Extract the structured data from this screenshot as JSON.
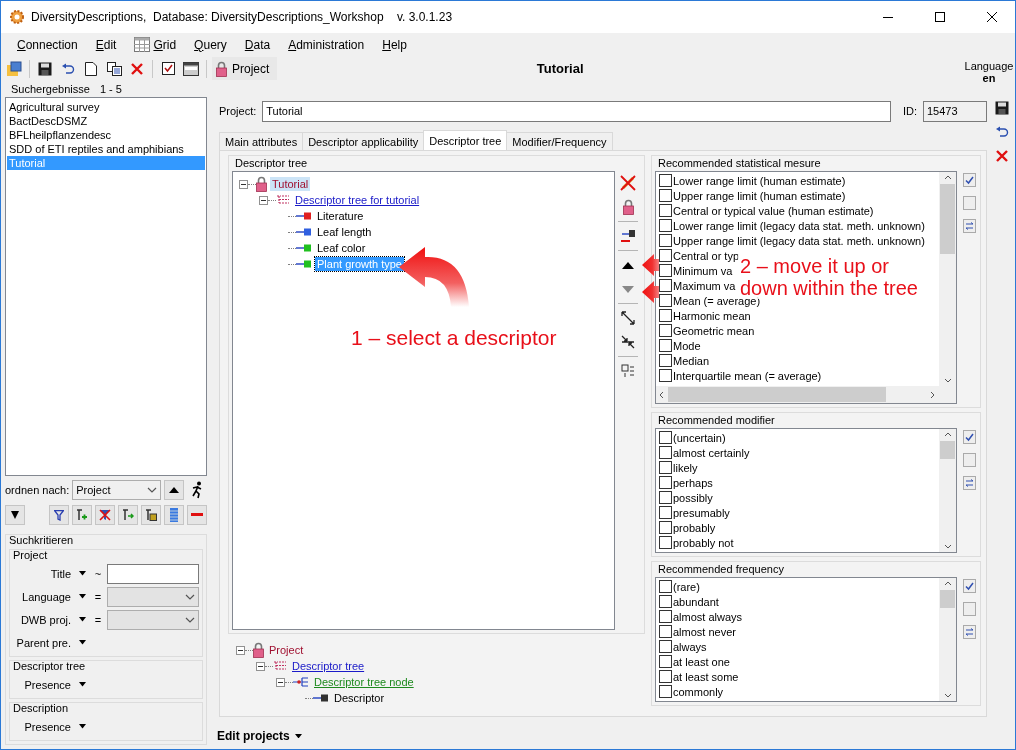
{
  "window": {
    "title": "DiversityDescriptions,  Database: DiversityDescriptions_Workshop    v. 3.0.1.23"
  },
  "menu": [
    {
      "label": "Connection",
      "icon": false
    },
    {
      "label": "Edit",
      "icon": false
    },
    {
      "label": "Grid",
      "icon": true
    },
    {
      "label": "Query",
      "icon": false
    },
    {
      "label": "Data",
      "icon": false
    },
    {
      "label": "Administration",
      "icon": false
    },
    {
      "label": "Help",
      "icon": false
    }
  ],
  "toolbar": {
    "project_button": "Project",
    "title": "Tutorial",
    "language_label": "Language",
    "language": "en"
  },
  "search_results": {
    "label": "Suchergebnisse",
    "range": "1 - 5",
    "items": [
      {
        "label": "Agricultural survey",
        "selected": false
      },
      {
        "label": "BactDescDSMZ",
        "selected": false
      },
      {
        "label": "BFLheilpflanzendesc",
        "selected": false
      },
      {
        "label": "SDD of ETI reptiles and amphibians",
        "selected": false
      },
      {
        "label": "Tutorial",
        "selected": true
      }
    ]
  },
  "sort": {
    "label": "ordnen nach:",
    "value": "Project"
  },
  "search_criteria": {
    "title": "Suchkritieren",
    "groups": [
      {
        "title": "Project",
        "fields": [
          {
            "label": "Title",
            "operator": "~",
            "kind": "text"
          },
          {
            "label": "Language",
            "operator": "=",
            "kind": "select"
          },
          {
            "label": "DWB proj.",
            "operator": "=",
            "kind": "select"
          },
          {
            "label": "Parent pre.",
            "kind": "none"
          }
        ]
      },
      {
        "title": "Descriptor tree",
        "fields": [
          {
            "label": "Presence",
            "kind": "none"
          }
        ]
      },
      {
        "title": "Description",
        "fields": [
          {
            "label": "Presence",
            "kind": "none"
          }
        ]
      }
    ]
  },
  "project": {
    "label": "Project:",
    "value": "Tutorial",
    "id_label": "ID:",
    "id": "15473"
  },
  "tabs": [
    {
      "label": "Main attributes",
      "selected": false
    },
    {
      "label": "Descriptor applicability",
      "selected": false
    },
    {
      "label": "Descriptor tree",
      "selected": true
    },
    {
      "label": "Modifier/Frequency",
      "selected": false
    }
  ],
  "descriptor_tree": {
    "title": "Descriptor tree",
    "nodes": [
      {
        "label": "Tutorial",
        "kind": "project",
        "selected": false,
        "highlighted": true,
        "children": [
          {
            "label": "Descriptor tree for tutorial",
            "kind": "tree",
            "selected": false,
            "highlighted": false,
            "children": [
              {
                "label": "Literature",
                "kind": "descriptor",
                "color": "#e02020",
                "selected": false,
                "highlighted": false
              },
              {
                "label": "Leaf length",
                "kind": "descriptor",
                "color": "#2f5fe0",
                "selected": false,
                "highlighted": false
              },
              {
                "label": "Leaf color",
                "kind": "descriptor",
                "color": "#20c020",
                "selected": false,
                "highlighted": false
              },
              {
                "label": "Plant growth type",
                "kind": "descriptor",
                "color": "#20c020",
                "selected": true,
                "highlighted": false
              }
            ]
          }
        ]
      }
    ]
  },
  "legend_tree": [
    {
      "label": "Project",
      "kind": "project",
      "children": [
        {
          "label": "Descriptor tree",
          "kind": "tree",
          "children": [
            {
              "label": "Descriptor tree node",
              "kind": "node",
              "children": [
                {
                  "label": "Descriptor",
                  "kind": "descriptor",
                  "color": "#303030"
                }
              ]
            }
          ]
        }
      ]
    }
  ],
  "stat_measures": {
    "title": "Recommended statistical mesure",
    "items": [
      {
        "label": "Lower range limit (human estimate)",
        "checked": false
      },
      {
        "label": "Upper range limit (human estimate)",
        "checked": false
      },
      {
        "label": "Central or typical value (human estimate)",
        "checked": false
      },
      {
        "label": "Lower range limit (legacy data stat. meth. unknown)",
        "checked": false
      },
      {
        "label": "Upper range limit (legacy data stat. meth. unknown)",
        "checked": false
      },
      {
        "label": "Central or typ",
        "checked": false
      },
      {
        "label": "Minimum va",
        "checked": false
      },
      {
        "label": "Maximum va",
        "checked": false
      },
      {
        "label": "Mean (= average)",
        "checked": false
      },
      {
        "label": "Harmonic mean",
        "checked": false
      },
      {
        "label": "Geometric mean",
        "checked": false
      },
      {
        "label": "Mode",
        "checked": false
      },
      {
        "label": "Median",
        "checked": false
      },
      {
        "label": "Interquartile mean (= average)",
        "checked": false
      }
    ]
  },
  "modifiers": {
    "title": "Recommended modifier",
    "items": [
      {
        "label": "(uncertain)",
        "checked": false
      },
      {
        "label": "almost certainly",
        "checked": false
      },
      {
        "label": "likely",
        "checked": false
      },
      {
        "label": "perhaps",
        "checked": false
      },
      {
        "label": "possibly",
        "checked": false
      },
      {
        "label": "presumably",
        "checked": false
      },
      {
        "label": "probably",
        "checked": false
      },
      {
        "label": "probably not",
        "checked": false
      }
    ]
  },
  "frequencies": {
    "title": "Recommended frequency",
    "items": [
      {
        "label": "(rare)",
        "checked": false
      },
      {
        "label": "abundant",
        "checked": false
      },
      {
        "label": "almost always",
        "checked": false
      },
      {
        "label": "almost never",
        "checked": false
      },
      {
        "label": "always",
        "checked": false
      },
      {
        "label": "at least one",
        "checked": false
      },
      {
        "label": "at least some",
        "checked": false
      },
      {
        "label": "commonly",
        "checked": false
      }
    ]
  },
  "status_bar": {
    "label": "Edit projects"
  },
  "annotations": [
    {
      "text": "1 – select a descriptor"
    },
    {
      "text": "2 – move it up or down within the tree"
    }
  ]
}
